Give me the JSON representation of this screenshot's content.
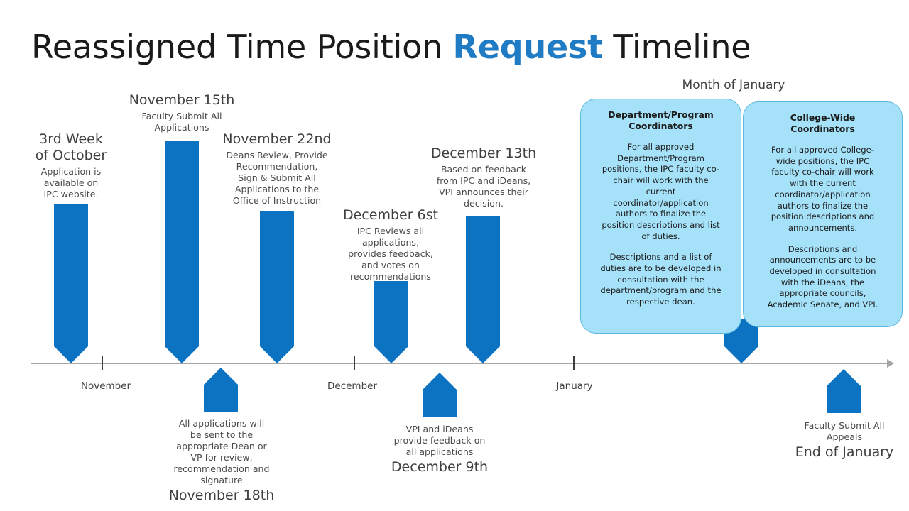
{
  "title": {
    "before": "Reassigned Time Position ",
    "accent": "Request",
    "after": " Timeline"
  },
  "colors": {
    "pin_blue": "#0C73C2",
    "accent_blue": "#1F7BC4",
    "callout_fill": "#A5E1F9",
    "callout_border": "#5BB8DE",
    "axis_gray": "#a6a6a6"
  },
  "axis": {
    "months": [
      {
        "label": "November"
      },
      {
        "label": "December"
      },
      {
        "label": "January"
      }
    ]
  },
  "milestones_above": [
    {
      "date": "3rd Week\nof October",
      "body": "Application is\navailable on\nIPC website."
    },
    {
      "date": "November 15th",
      "body": "Faculty  Submit All\nApplications"
    },
    {
      "date": "November 22nd",
      "body": "Deans Review,  Provide\nRecommendation,\nSign & Submit  All\nApplications  to the\nOffice of Instruction"
    },
    {
      "date": "December 6st",
      "body": "IPC Reviews all\napplications,\nprovides feedback,\nand  votes on\nrecommendations"
    },
    {
      "date": "December 13th",
      "body": "Based on feedback\nfrom IPC and  iDeans,\nVPI announces  their\ndecision."
    }
  ],
  "milestones_below": [
    {
      "body": "All applications will\nbe sent to the\nappropriate Dean or\nVP for review,\nrecommendation  and\nsignature",
      "date": "November 18th"
    },
    {
      "body": "VPI and iDeans\nprovide feedback on\nall applications",
      "date": "December 9th"
    },
    {
      "body": "Faculty  Submit All\nAppeals",
      "date": "End of January"
    }
  ],
  "january_section": {
    "heading": "Month of January",
    "callouts": [
      {
        "title": "Department/Program\nCoordinators",
        "para1": "For all approved\nDepartment/Program\npositions, the IPC faculty  co-\nchair will  work with the\ncurrent\ncoordinator/application\nauthors to finalize  the\nposition descriptions  and list\nof duties.",
        "para2": "Descriptions and a list of\nduties are to be developed  in\nconsultation  with the\ndepartment/program  and the\nrespective  dean."
      },
      {
        "title": "College-Wide\nCoordinators",
        "para1": "For all approved College-\nwide  positions, the IPC\nfaculty  co-chair will  work\nwith the current\ncoordinator/application\nauthors  to finalize  the\nposition  descriptions  and\nannouncements.",
        "para2": "Descriptions and\nannouncements  are to be\ndeveloped  in consultation\nwith the iDeans, the\nappropriate  councils,\nAcademic  Senate, and VPI."
      }
    ]
  }
}
